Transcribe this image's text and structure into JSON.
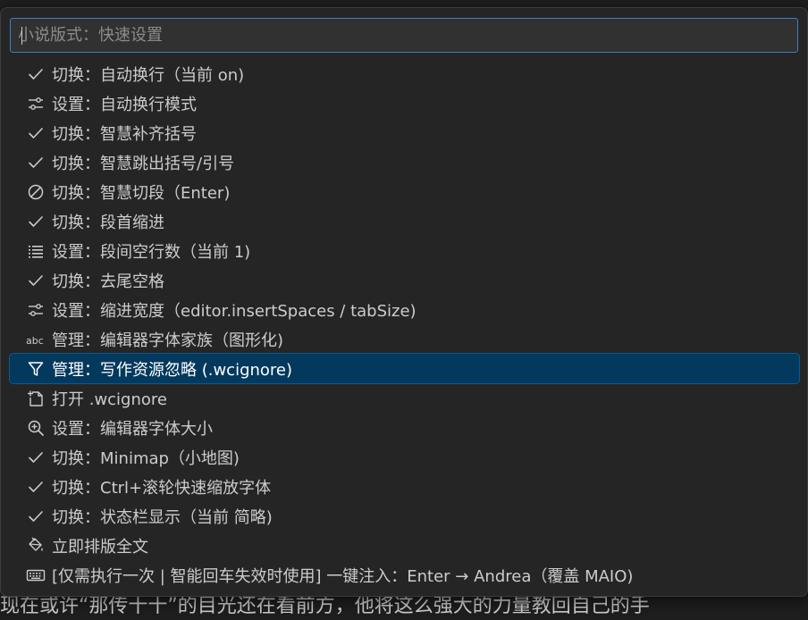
{
  "quick_pick": {
    "placeholder": "小说版式：快速设置",
    "value": ""
  },
  "items": [
    {
      "icon": "check-icon",
      "label": "切换：自动换行（当前 on)"
    },
    {
      "icon": "settings-sliders-icon",
      "label": "设置：自动换行模式"
    },
    {
      "icon": "check-icon",
      "label": "切换：智慧补齐括号"
    },
    {
      "icon": "check-icon",
      "label": "切换：智慧跳出括号/引号"
    },
    {
      "icon": "circle-slash-icon",
      "label": "切换：智慧切段（Enter)"
    },
    {
      "icon": "check-icon",
      "label": "切换：段首缩进"
    },
    {
      "icon": "list-icon",
      "label": "设置：段间空行数（当前 1)"
    },
    {
      "icon": "check-icon",
      "label": "切换：去尾空格"
    },
    {
      "icon": "settings-sliders-icon",
      "label": "设置：缩进宽度（editor.insertSpaces / tabSize)"
    },
    {
      "icon": "text-abc-icon",
      "label": "管理：编辑器字体家族（图形化)"
    },
    {
      "icon": "filter-icon",
      "label": "管理：写作资源忽略 (.wcignore)",
      "selected": true
    },
    {
      "icon": "new-file-icon",
      "label": "打开 .wcignore"
    },
    {
      "icon": "zoom-in-icon",
      "label": "设置：编辑器字体大小"
    },
    {
      "icon": "check-icon",
      "label": "切换：Minimap（小地图)"
    },
    {
      "icon": "check-icon",
      "label": "切换：Ctrl+滚轮快速缩放字体"
    },
    {
      "icon": "check-icon",
      "label": "切换：状态栏显示（当前 简略)"
    },
    {
      "icon": "paint-bucket-icon",
      "label": "立即排版全文"
    },
    {
      "icon": "keyboard-icon",
      "label": "[仅需执行一次 | 智能回车失效时使用] 一键注入：Enter → Andrea（覆盖 MAIO)"
    }
  ],
  "editor": {
    "background_text": "现在或许“那传十十”的目光还在看前方，他将这么强大的力量教回自己的手"
  },
  "colors": {
    "panel_bg": "#252526",
    "selected_bg": "#04395e",
    "input_border": "#3b7fc4",
    "text": "#cccccc"
  }
}
